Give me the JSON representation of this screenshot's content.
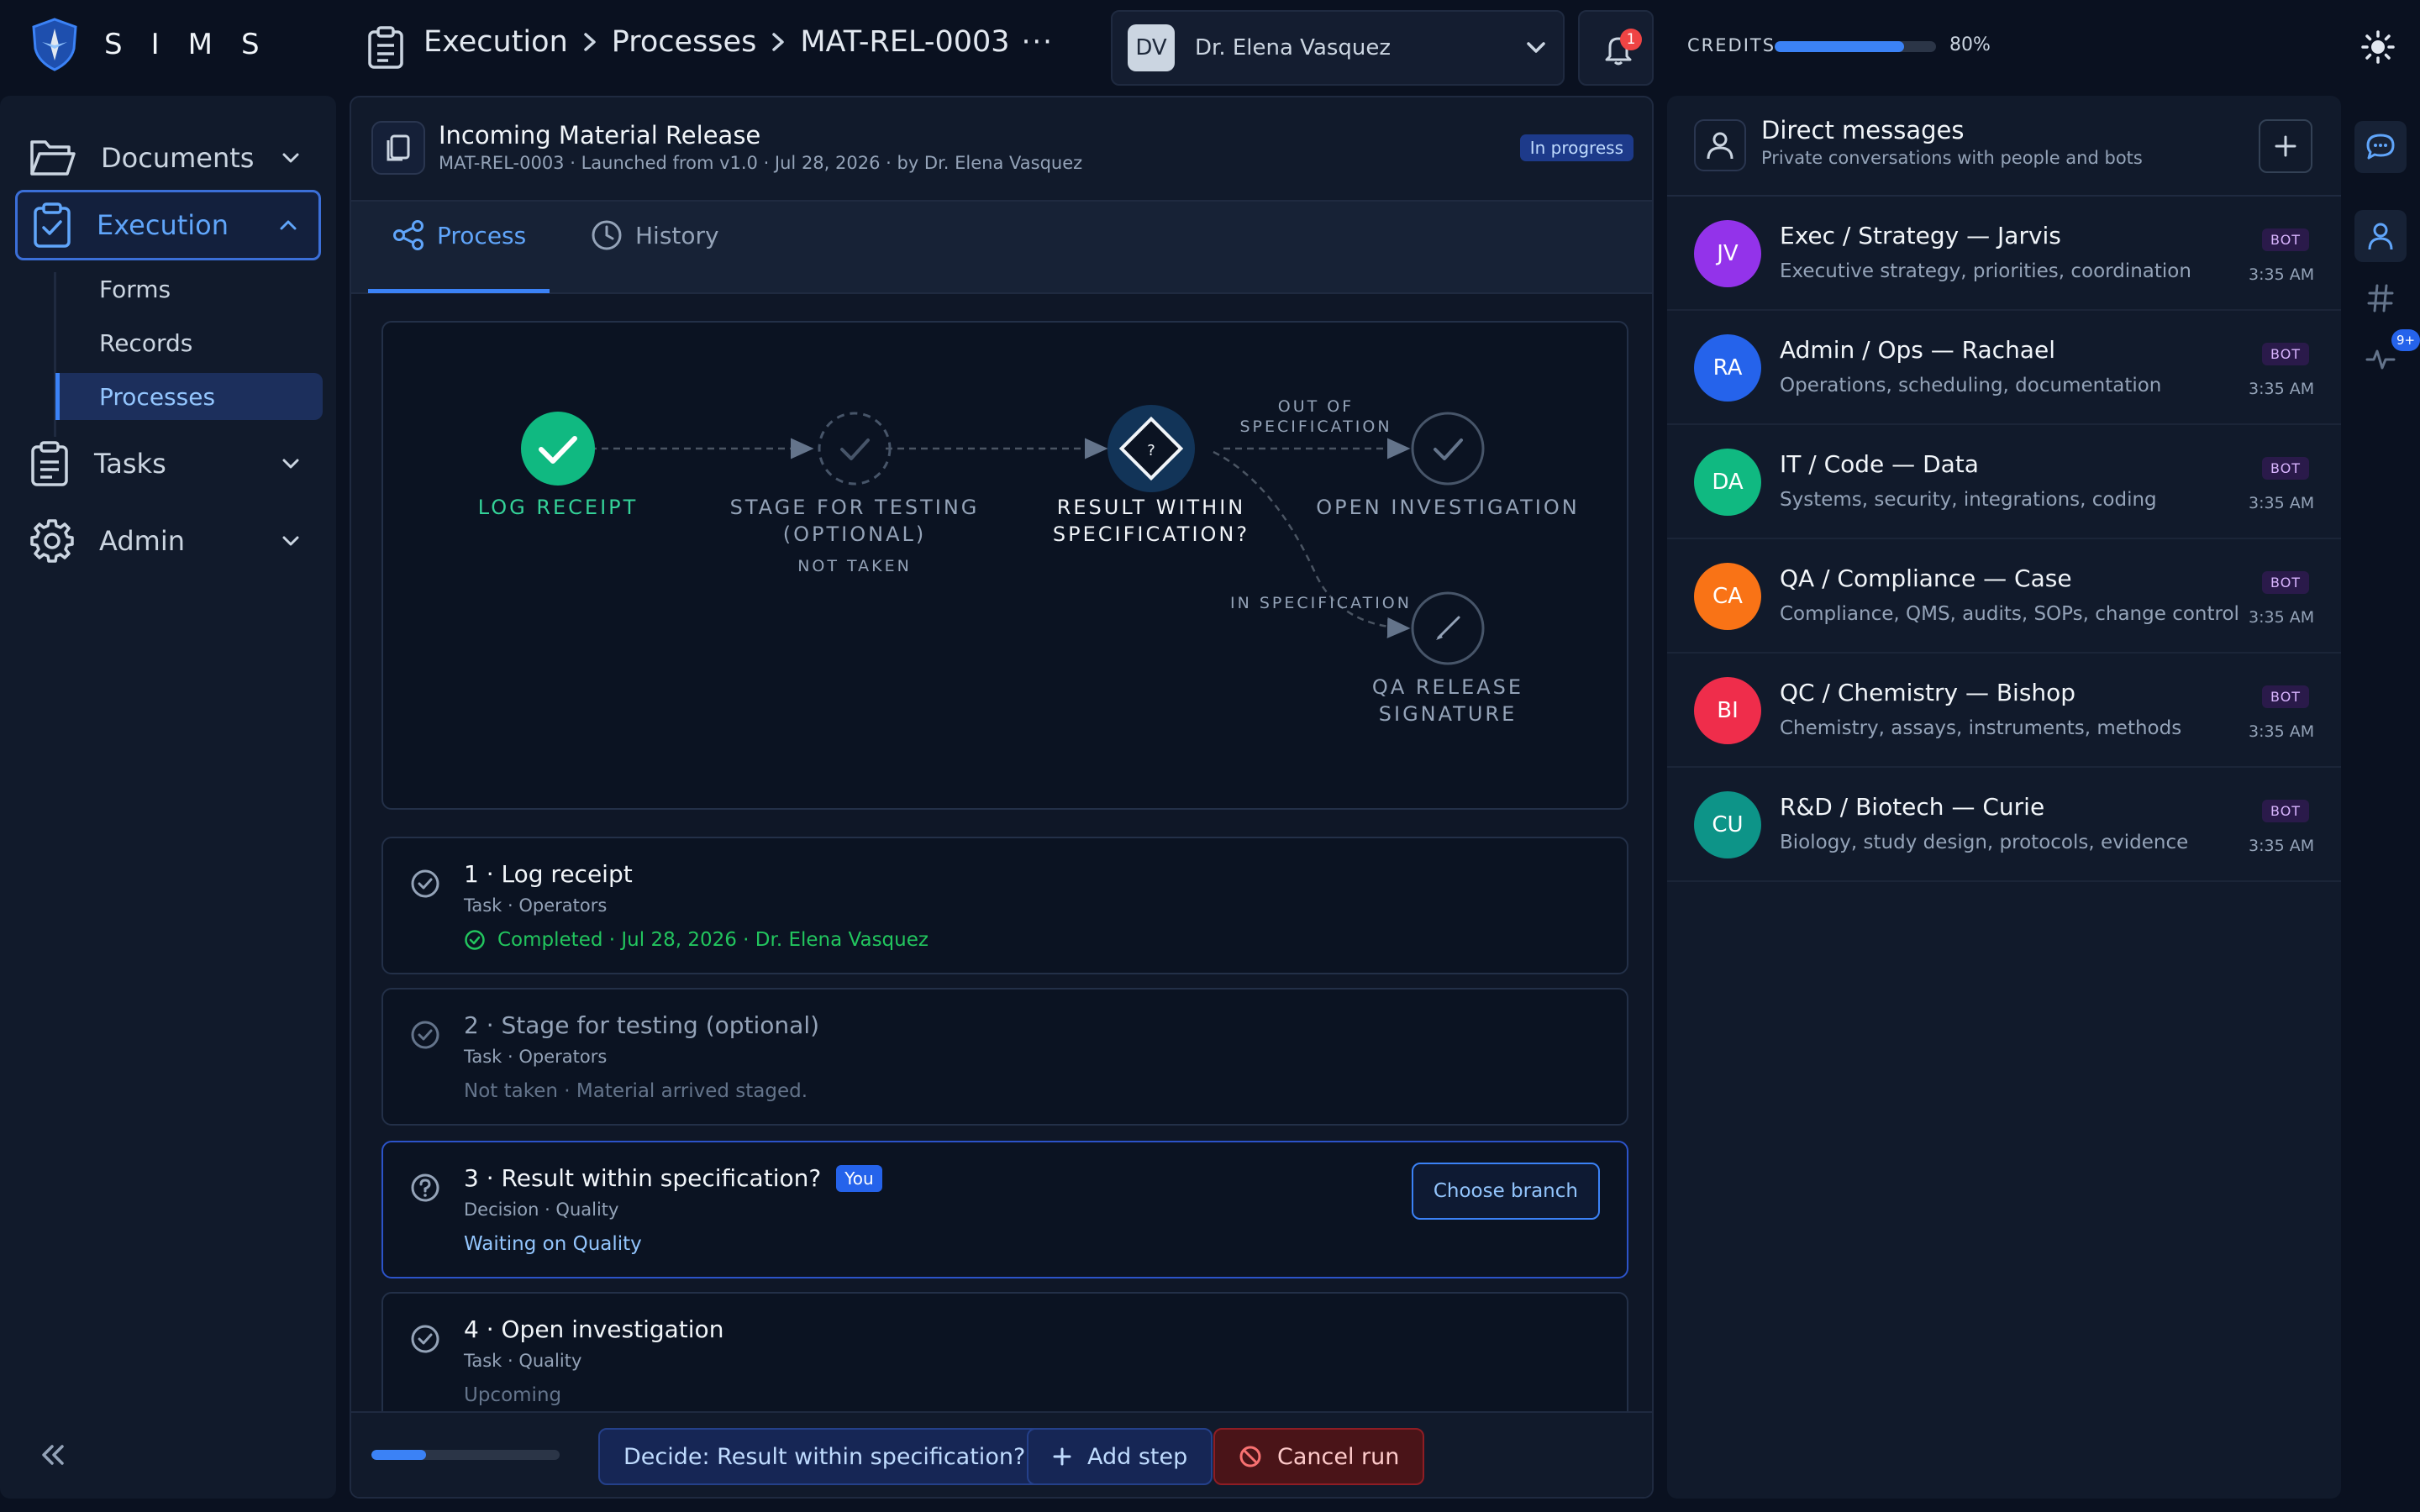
{
  "app": {
    "name": "SIMS"
  },
  "breadcrumb": [
    "Execution",
    "Processes",
    "MAT-REL-0003"
  ],
  "breadcrumb_more": "···",
  "user": {
    "initials": "DV",
    "name": "Dr. Elena Vasquez"
  },
  "notifications": {
    "count": "1"
  },
  "credits": {
    "label": "CREDITS",
    "percent_text": "80%",
    "percent": 80
  },
  "sidebar": {
    "items": [
      {
        "label": "Documents"
      },
      {
        "label": "Execution"
      },
      {
        "label": "Tasks"
      },
      {
        "label": "Admin"
      }
    ],
    "sub_items": [
      "Forms",
      "Records",
      "Processes"
    ]
  },
  "run": {
    "title": "Incoming Material Release",
    "subtitle": "MAT-REL-0003 · Launched from v1.0 · Jul 28, 2026 · by Dr. Elena Vasquez",
    "status": "In progress"
  },
  "tabs": [
    {
      "label": "Process"
    },
    {
      "label": "History"
    }
  ],
  "flow": {
    "nodes": [
      {
        "label_lines": [
          "LOG RECEIPT"
        ],
        "note": "",
        "state": "done"
      },
      {
        "label_lines": [
          "STAGE FOR TESTING",
          "(OPTIONAL)"
        ],
        "note": "NOT TAKEN",
        "state": "skipped"
      },
      {
        "label_lines": [
          "RESULT WITHIN",
          "SPECIFICATION?"
        ],
        "note": "",
        "state": "decision"
      },
      {
        "label_lines": [
          "OPEN INVESTIGATION"
        ],
        "note": "",
        "state": "upcoming"
      },
      {
        "label_lines": [
          "QA RELEASE",
          "SIGNATURE"
        ],
        "note": "",
        "state": "upcoming"
      }
    ],
    "edge_labels": {
      "out_of_spec": [
        "OUT OF",
        "SPECIFICATION"
      ],
      "in_spec": "IN SPECIFICATION"
    }
  },
  "steps": [
    {
      "title": "1 · Log receipt",
      "meta": "Task · Operators",
      "status": "Completed · Jul 28, 2026 · Dr. Elena Vasquez"
    },
    {
      "title": "2 · Stage for testing (optional)",
      "meta": "Task · Operators",
      "status": "Not taken · Material arrived staged."
    },
    {
      "title": "3 · Result within specification?",
      "meta": "Decision · Quality",
      "status": "Waiting on Quality",
      "badge": "You",
      "action": "Choose branch"
    },
    {
      "title": "4 · Open investigation",
      "meta": "Task · Quality",
      "status": "Upcoming"
    }
  ],
  "footer": {
    "progress": 0.29,
    "decide_label": "Decide: Result within specification?",
    "add_step_label": "Add step",
    "cancel_label": "Cancel run"
  },
  "chat": {
    "title": "Direct messages",
    "subtitle": "Private conversations with people and bots",
    "contacts": [
      {
        "initials": "JV",
        "name": "Exec / Strategy — Jarvis",
        "desc": "Executive strategy, priorities, coordination",
        "badge": "BOT",
        "time": "3:35 AM",
        "color": "#9333ea"
      },
      {
        "initials": "RA",
        "name": "Admin / Ops — Rachael",
        "desc": "Operations, scheduling, documentation",
        "badge": "BOT",
        "time": "3:35 AM",
        "color": "#2563eb"
      },
      {
        "initials": "DA",
        "name": "IT / Code — Data",
        "desc": "Systems, security, integrations, coding",
        "badge": "BOT",
        "time": "3:35 AM",
        "color": "#10b981"
      },
      {
        "initials": "CA",
        "name": "QA / Compliance — Case",
        "desc": "Compliance, QMS, audits, SOPs, change control",
        "badge": "BOT",
        "time": "3:35 AM",
        "color": "#f97316"
      },
      {
        "initials": "BI",
        "name": "QC / Chemistry — Bishop",
        "desc": "Chemistry, assays, instruments, methods",
        "badge": "BOT",
        "time": "3:35 AM",
        "color": "#ef2d4b"
      },
      {
        "initials": "CU",
        "name": "R&D / Biotech — Curie",
        "desc": "Biology, study design, protocols, evidence",
        "badge": "BOT",
        "time": "3:35 AM",
        "color": "#0d9488"
      }
    ]
  },
  "rail": {
    "activity_badge": "9+"
  },
  "colors": {
    "accent": "#3b82f6",
    "success": "#22c55e",
    "danger": "#ef4444",
    "background": "#0a1120"
  }
}
